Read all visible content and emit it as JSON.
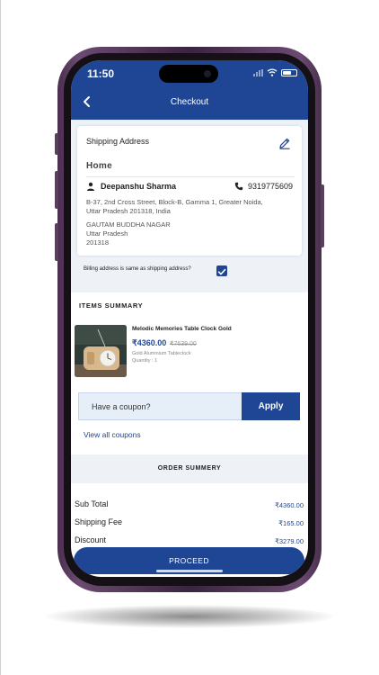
{
  "status_bar": {
    "time": "11:50"
  },
  "header": {
    "title": "Checkout"
  },
  "shipping": {
    "section_title": "Shipping Address",
    "address_type": "Home",
    "name": "Deepanshu Sharma",
    "phone": "9319775609",
    "address_line1": "B-37, 2nd Cross Street, Block-B, Gamma 1, Greater Noida,",
    "address_line2": "Uttar Pradesh 201318, India",
    "city": "GAUTAM BUDDHA NAGAR",
    "state": "Uttar Pradesh",
    "pincode": "201318"
  },
  "billing": {
    "label": "Billing address is same as shipping address?",
    "checked": true
  },
  "items_summary": {
    "title": "ITEMS SUMMARY",
    "items": [
      {
        "name": "Melodic Memories Table Clock Gold",
        "price": "₹4360.00",
        "mrp": "₹7639.00",
        "variant": "Gold Aluminium Tableclock",
        "quantity": "Quantity :  1"
      }
    ]
  },
  "coupon": {
    "placeholder": "Have a coupon?",
    "apply_label": "Apply",
    "view_all": "View all coupons"
  },
  "order_summary": {
    "title": "ORDER SUMMERY",
    "rows": [
      {
        "label": "Sub Total",
        "value": "₹4360.00"
      },
      {
        "label": "Shipping Fee",
        "value": "₹165.00"
      },
      {
        "label": "Discount",
        "value": "₹3279.00"
      }
    ]
  },
  "proceed_label": "PROCEED",
  "colors": {
    "primary": "#1e4694",
    "background": "#eef2f7",
    "phone_frame": "#5b3d60"
  },
  "icons": [
    "back-chevron-icon",
    "edit-pencil-icon",
    "person-icon",
    "phone-icon",
    "checkbox-check-icon",
    "wifi-icon",
    "battery-icon",
    "signal-icon"
  ]
}
